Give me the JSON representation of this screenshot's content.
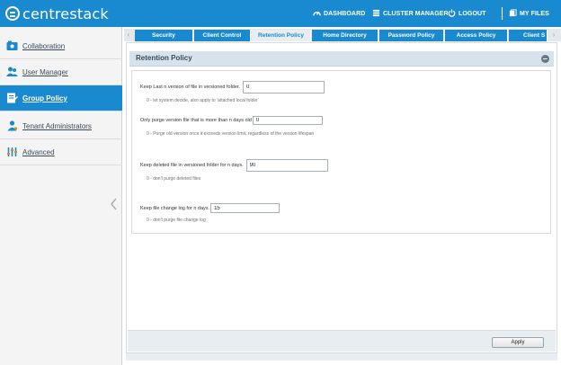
{
  "header": {
    "brand": "centrestack",
    "nav": {
      "dashboard": "DASHBOARD",
      "cluster_manager": "CLUSTER MANAGER",
      "logout": "LOGOUT",
      "my_files": "MY FILES"
    },
    "icons": [
      "logo-icon",
      "dashboard-icon",
      "cluster-icon",
      "power-icon",
      "files-icon"
    ],
    "accent_color": "#1a8ad0"
  },
  "sidebar": {
    "items": [
      {
        "label": "Collaboration",
        "icon": "collaboration-icon",
        "active": false
      },
      {
        "label": "User Manager",
        "icon": "users-icon",
        "active": false
      },
      {
        "label": "Group Policy",
        "icon": "policy-icon",
        "active": true
      },
      {
        "label": "Tenant Administrators",
        "icon": "admin-icon",
        "active": false
      },
      {
        "label": "Advanced",
        "icon": "advanced-icon",
        "active": false
      }
    ]
  },
  "tabs": [
    {
      "label": "Security",
      "active": false
    },
    {
      "label": "Client Control",
      "active": false
    },
    {
      "label": "Retention Policy",
      "active": true
    },
    {
      "label": "Home Directory",
      "active": false
    },
    {
      "label": "Password Policy",
      "active": false
    },
    {
      "label": "Access Policy",
      "active": false
    },
    {
      "label": "Client S",
      "active": false
    }
  ],
  "panel": {
    "title": "Retention Policy",
    "fields": [
      {
        "label": "Keep Last n version of file in versioned folder.",
        "value": "0",
        "hint": "0 - let system decide, also apply to 'attached local folder'"
      },
      {
        "label": "Only purge version file that is more than n days old",
        "value": "0",
        "hint": "0 - Purge old version once it exceeds version limit, regardless of the version lifespan"
      },
      {
        "label": "Keep deleted file in versioned folder for n days.",
        "value": "90",
        "hint": "0 - don't purge deleted files"
      },
      {
        "label": "Keep file change log for n days.",
        "value": "15",
        "hint": "0 - don't purge file change log"
      }
    ]
  },
  "footer": {
    "apply_label": "Apply"
  }
}
